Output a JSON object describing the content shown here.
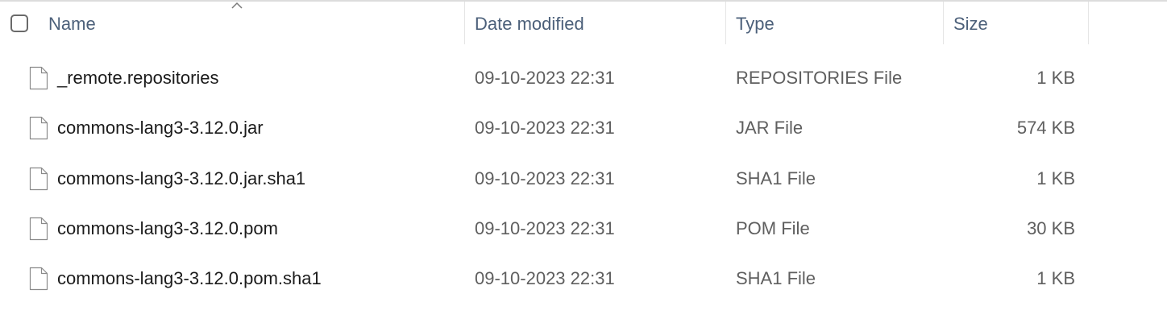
{
  "columns": {
    "name": "Name",
    "date_modified": "Date modified",
    "type": "Type",
    "size": "Size"
  },
  "files": [
    {
      "name": "_remote.repositories",
      "date": "09-10-2023 22:31",
      "type": "REPOSITORIES File",
      "size": "1 KB",
      "icon": "generic-file-icon"
    },
    {
      "name": "commons-lang3-3.12.0.jar",
      "date": "09-10-2023 22:31",
      "type": "JAR File",
      "size": "574 KB",
      "icon": "generic-file-icon"
    },
    {
      "name": "commons-lang3-3.12.0.jar.sha1",
      "date": "09-10-2023 22:31",
      "type": "SHA1 File",
      "size": "1 KB",
      "icon": "generic-file-icon"
    },
    {
      "name": "commons-lang3-3.12.0.pom",
      "date": "09-10-2023 22:31",
      "type": "POM File",
      "size": "30 KB",
      "icon": "generic-file-icon"
    },
    {
      "name": "commons-lang3-3.12.0.pom.sha1",
      "date": "09-10-2023 22:31",
      "type": "SHA1 File",
      "size": "1 KB",
      "icon": "generic-file-icon"
    }
  ],
  "colors": {
    "header_text": "#4c607a",
    "name_text": "#1b1b1b",
    "detail_text": "#5f5f5f"
  }
}
